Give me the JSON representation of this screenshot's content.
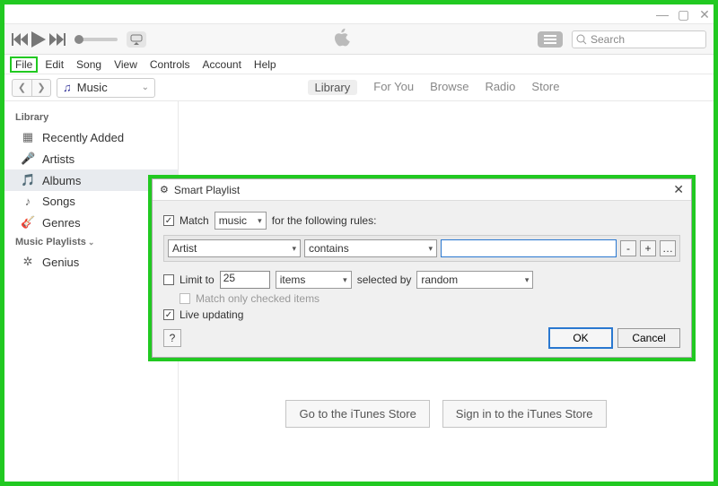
{
  "window_controls": {
    "min": "—",
    "max": "▢",
    "close": "✕"
  },
  "toolbar": {
    "search_placeholder": "Search"
  },
  "menubar": {
    "items": [
      "File",
      "Edit",
      "Song",
      "View",
      "Controls",
      "Account",
      "Help"
    ]
  },
  "subbar": {
    "media_selector": "Music",
    "tabs": [
      "Library",
      "For You",
      "Browse",
      "Radio",
      "Store"
    ],
    "active_tab": "Library"
  },
  "sidebar": {
    "library_header": "Library",
    "library_items": [
      "Recently Added",
      "Artists",
      "Albums",
      "Songs",
      "Genres"
    ],
    "selected": "Albums",
    "playlists_header": "Music Playlists",
    "playlists_items": [
      "Genius"
    ]
  },
  "content": {
    "buttons": {
      "go": "Go to the iTunes Store",
      "signin": "Sign in to the iTunes Store"
    }
  },
  "dialog": {
    "title": "Smart Playlist",
    "match_label_pre": "Match",
    "match_type": "music",
    "match_label_post": "for the following rules:",
    "rule": {
      "field": "Artist",
      "condition": "contains",
      "value": "",
      "btn_minus": "-",
      "btn_plus": "+",
      "btn_dots": "…"
    },
    "limit_label": "Limit to",
    "limit_value": "25",
    "limit_unit": "items",
    "selected_by_label": "selected by",
    "selected_by_value": "random",
    "match_checked_label": "Match only checked items",
    "live_label": "Live updating",
    "help": "?",
    "ok": "OK",
    "cancel": "Cancel"
  }
}
